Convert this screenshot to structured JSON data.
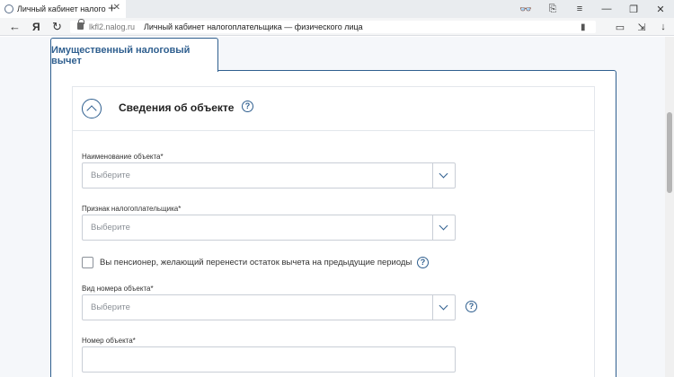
{
  "browser": {
    "tab": {
      "title": "Личный кабинет налого",
      "close": "✕"
    },
    "new_tab": "+",
    "nav": {
      "back": "←",
      "yandex": "Я",
      "reload": "↻"
    },
    "url_domain": "lkfl2.nalog.ru",
    "page_title": "Личный кабинет налогоплательщика — физического лица",
    "bookmark_glyph": "▮",
    "chrome_icons": [
      "👓",
      "⎘",
      "≡",
      "—",
      "❐",
      "✕"
    ],
    "addr_icons": [
      "▭",
      "⇲",
      "↓"
    ]
  },
  "page": {
    "section_tab": "Имущественный налоговый вычет",
    "card_title": "Сведения об объекте",
    "help_glyph": "?",
    "fields": {
      "object_name": {
        "label": "Наименование объекта*",
        "value": "Выберите"
      },
      "taxpayer_attr": {
        "label": "Признак налогоплательщика*",
        "value": "Выберите"
      },
      "pensioner": {
        "label": "Вы пенсионер, желающий перенести остаток вычета на предыдущие периоды",
        "checked": false
      },
      "object_number_type": {
        "label": "Вид номера объекта*",
        "value": "Выберите"
      },
      "object_number": {
        "label": "Номер объекта*",
        "value": ""
      }
    }
  },
  "colors": {
    "accent": "#2f5f8f",
    "border": "#c9ced6"
  }
}
